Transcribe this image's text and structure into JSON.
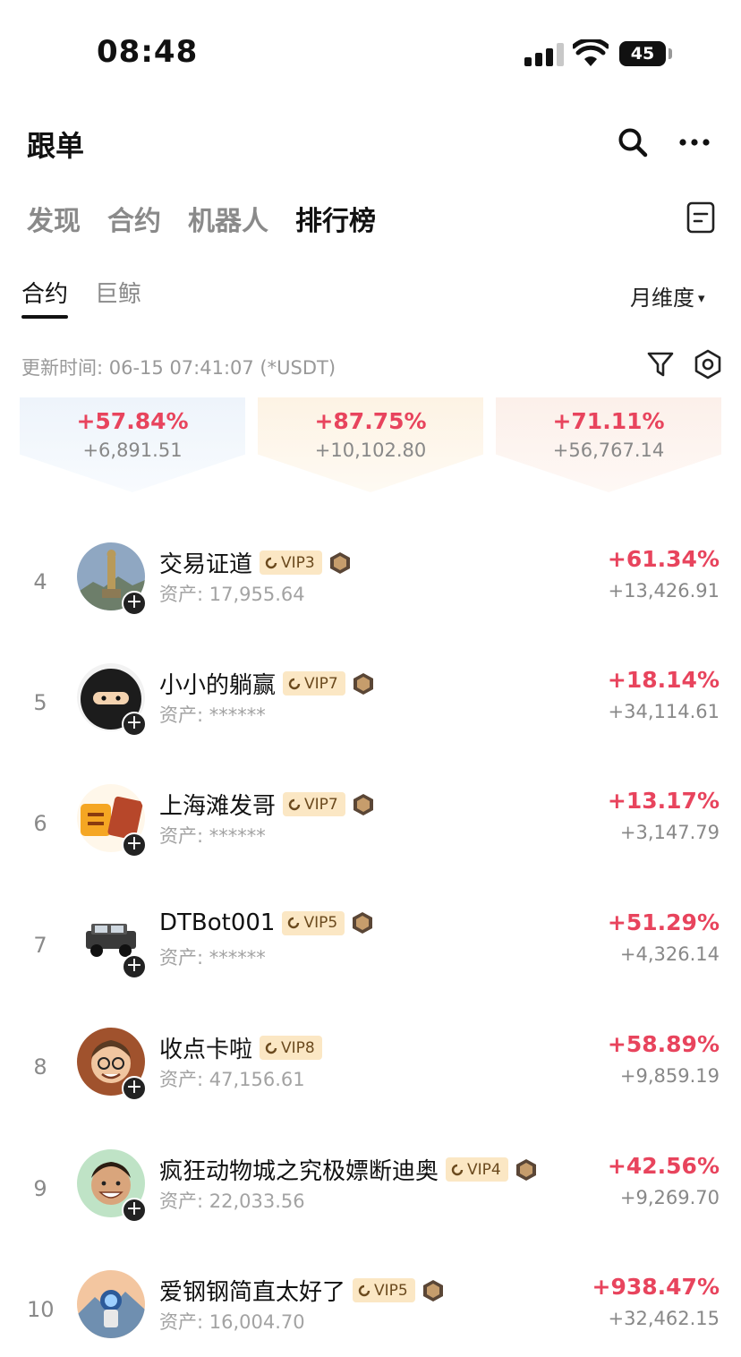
{
  "status_bar": {
    "time": "08:48",
    "battery": "45"
  },
  "header": {
    "title": "跟单"
  },
  "main_tabs": [
    "发现",
    "合约",
    "机器人",
    "排行榜"
  ],
  "sub_tabs": [
    "合约",
    "巨鲸"
  ],
  "period_selector": {
    "label": "月维度",
    "arrow": "▾"
  },
  "update_text": "更新时间: 06-15 07:41:07 (*USDT)",
  "top3": [
    {
      "percent": "+57.84%",
      "amount": "+6,891.51"
    },
    {
      "percent": "+87.75%",
      "amount": "+10,102.80"
    },
    {
      "percent": "+71.11%",
      "amount": "+56,767.14"
    }
  ],
  "colors": {
    "profit": "#e8445d",
    "vip_bg": "#fbe7c4",
    "vip_text": "#6b4a1e"
  },
  "rows": [
    {
      "rank": "4",
      "name": "交易证道",
      "vip": "VIP3",
      "assets": "资产: 17,955.64",
      "percent": "+61.34%",
      "amount": "+13,426.91",
      "avatar": "statue-avatar",
      "medal": true
    },
    {
      "rank": "5",
      "name": "小小的躺赢",
      "vip": "VIP7",
      "assets": "资产: ******",
      "percent": "+18.14%",
      "amount": "+34,114.61",
      "avatar": "ninja-avatar",
      "medal": true
    },
    {
      "rank": "6",
      "name": "上海滩发哥",
      "vip": "VIP7",
      "assets": "资产: ******",
      "percent": "+13.17%",
      "amount": "+3,147.79",
      "avatar": "money-avatar",
      "medal": true
    },
    {
      "rank": "7",
      "name": "DTBot001",
      "vip": "VIP5",
      "assets": "资产: ******",
      "percent": "+51.29%",
      "amount": "+4,326.14",
      "avatar": "jeep-avatar",
      "medal": true
    },
    {
      "rank": "8",
      "name": "收点卡啦",
      "vip": "VIP8",
      "assets": "资产: 47,156.61",
      "percent": "+58.89%",
      "amount": "+9,859.19",
      "avatar": "man-glasses-avatar",
      "medal": false
    },
    {
      "rank": "9",
      "name": "疯狂动物城之究极嫖断迪奥",
      "vip": "VIP4",
      "assets": "资产: 22,033.56",
      "percent": "+42.56%",
      "amount": "+9,269.70",
      "avatar": "smiling-man-avatar",
      "medal": true
    },
    {
      "rank": "10",
      "name": "爱钢钢简直太好了",
      "vip": "VIP5",
      "assets": "资产: 16,004.70",
      "percent": "+938.47%",
      "amount": "+32,462.15",
      "avatar": "astronaut-avatar",
      "medal": true
    }
  ]
}
